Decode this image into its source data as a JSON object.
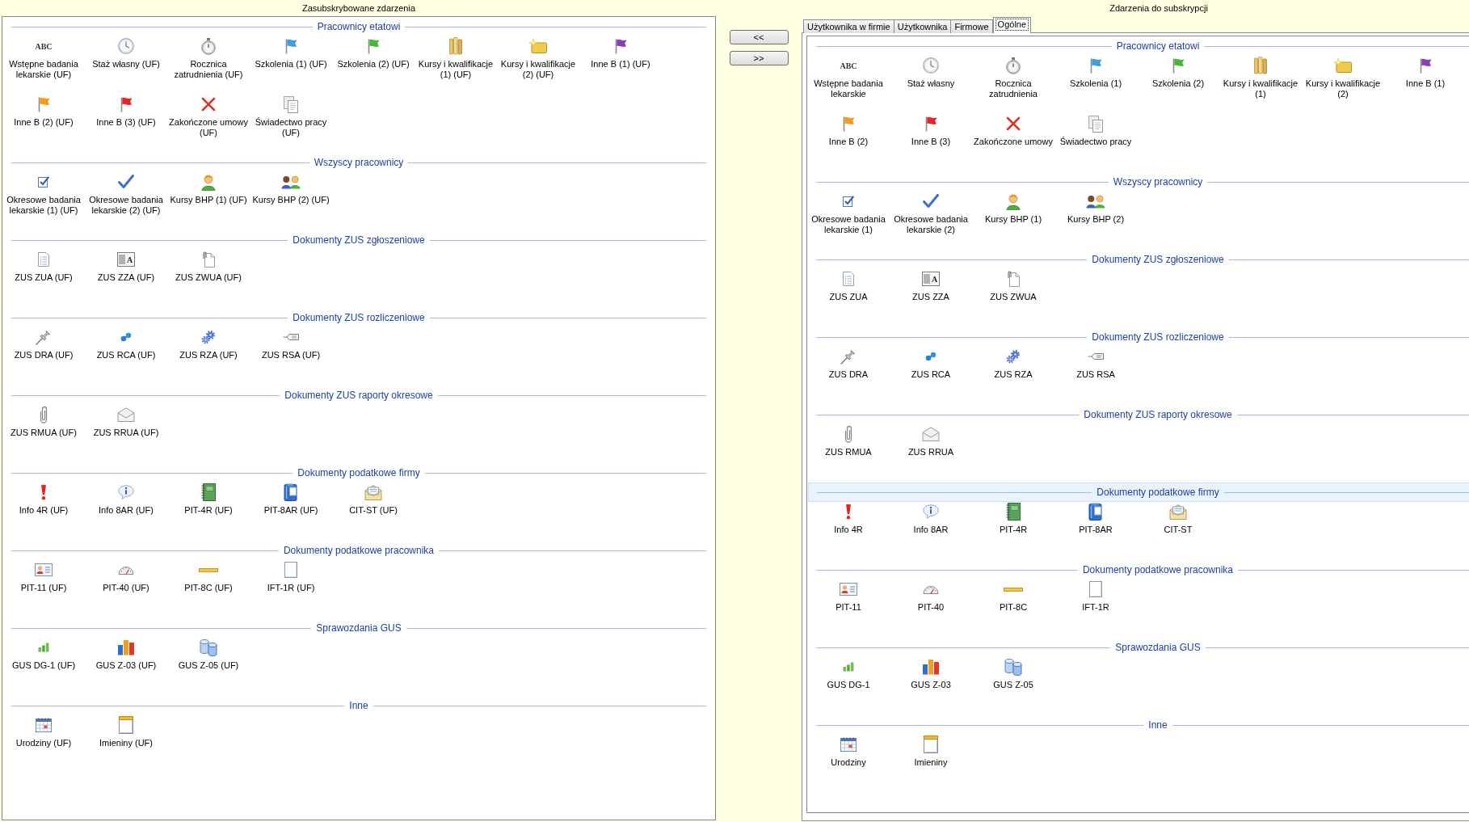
{
  "left_panel": {
    "title": "Zasubskrybowane zdarzenia",
    "groups": [
      {
        "title": "Pracownicy etatowi",
        "items": [
          {
            "label": "Wstępne badania lekarskie (UF)",
            "icon_text": "ABC"
          },
          {
            "label": "Staż własny (UF)"
          },
          {
            "label": "Rocznica zatrudnienia (UF)"
          },
          {
            "label": "Szkolenia (1) (UF)"
          },
          {
            "label": "Szkolenia (2) (UF)"
          },
          {
            "label": "Kursy i kwalifikacje (1) (UF)"
          },
          {
            "label": "Kursy i kwalifikacje (2) (UF)"
          },
          {
            "label": "Inne B (1) (UF)"
          },
          {
            "label": "Inne B (2) (UF)"
          },
          {
            "label": "Inne B (3) (UF)"
          },
          {
            "label": "Zakończone umowy (UF)"
          },
          {
            "label": "Świadectwo pracy (UF)"
          }
        ]
      },
      {
        "title": "Wszyscy pracownicy",
        "items": [
          {
            "label": "Okresowe badania lekarskie (1) (UF)"
          },
          {
            "label": "Okresowe badania lekarskie (2) (UF)"
          },
          {
            "label": "Kursy BHP (1) (UF)"
          },
          {
            "label": "Kursy BHP (2) (UF)"
          }
        ]
      },
      {
        "title": "Dokumenty ZUS zgłoszeniowe",
        "items": [
          {
            "label": "ZUS ZUA (UF)"
          },
          {
            "label": "ZUS ZZA (UF)",
            "icon_text": "A"
          },
          {
            "label": "ZUS ZWUA (UF)"
          }
        ]
      },
      {
        "title": "Dokumenty ZUS rozliczeniowe",
        "items": [
          {
            "label": "ZUS DRA (UF)"
          },
          {
            "label": "ZUS RCA (UF)"
          },
          {
            "label": "ZUS RZA (UF)"
          },
          {
            "label": "ZUS RSA (UF)"
          }
        ]
      },
      {
        "title": "Dokumenty ZUS raporty okresowe",
        "items": [
          {
            "label": "ZUS RMUA (UF)"
          },
          {
            "label": "ZUS RRUA (UF)"
          }
        ]
      },
      {
        "title": "Dokumenty podatkowe firmy",
        "items": [
          {
            "label": "Info 4R (UF)"
          },
          {
            "label": "Info 8AR (UF)"
          },
          {
            "label": "PIT-4R (UF)"
          },
          {
            "label": "PIT-8AR (UF)"
          },
          {
            "label": "CIT-ST (UF)"
          }
        ]
      },
      {
        "title": "Dokumenty podatkowe pracownika",
        "items": [
          {
            "label": "PIT-11 (UF)"
          },
          {
            "label": "PIT-40 (UF)"
          },
          {
            "label": "PIT-8C (UF)"
          },
          {
            "label": "IFT-1R (UF)"
          }
        ]
      },
      {
        "title": "Sprawozdania GUS",
        "items": [
          {
            "label": "GUS DG-1 (UF)"
          },
          {
            "label": "GUS Z-03 (UF)"
          },
          {
            "label": "GUS Z-05 (UF)"
          }
        ]
      },
      {
        "title": "Inne",
        "items": [
          {
            "label": "Urodziny (UF)"
          },
          {
            "label": "Imieniny (UF)"
          }
        ]
      }
    ]
  },
  "transfer_buttons": [
    "<<",
    ">>"
  ],
  "right_panel": {
    "title": "Zdarzenia do subskrypcji",
    "tabs": [
      {
        "label": "Użytkownika w firmie",
        "selected": false
      },
      {
        "label": "Użytkownika",
        "selected": false
      },
      {
        "label": "Firmowe",
        "selected": false
      },
      {
        "label": "Ogólne",
        "selected": true
      }
    ],
    "groups": [
      {
        "title": "Pracownicy etatowi",
        "highlighted": false,
        "items": [
          {
            "label": "Wstępne badania lekarskie",
            "icon_text": "ABC"
          },
          {
            "label": "Staż własny"
          },
          {
            "label": "Rocznica zatrudnienia"
          },
          {
            "label": "Szkolenia (1)"
          },
          {
            "label": "Szkolenia (2)"
          },
          {
            "label": "Kursy i kwalifikacje (1)"
          },
          {
            "label": "Kursy i kwalifikacje (2)"
          },
          {
            "label": "Inne B (1)"
          },
          {
            "label": "Inne B (2)"
          },
          {
            "label": "Inne B (3)"
          },
          {
            "label": "Zakończone umowy"
          },
          {
            "label": "Świadectwo pracy"
          }
        ]
      },
      {
        "title": "Wszyscy pracownicy",
        "highlighted": false,
        "items": [
          {
            "label": "Okresowe badania lekarskie (1)"
          },
          {
            "label": "Okresowe badania lekarskie (2)"
          },
          {
            "label": "Kursy BHP (1)"
          },
          {
            "label": "Kursy BHP (2)"
          }
        ]
      },
      {
        "title": "Dokumenty ZUS zgłoszeniowe",
        "highlighted": false,
        "items": [
          {
            "label": "ZUS ZUA"
          },
          {
            "label": "ZUS ZZA",
            "icon_text": "A"
          },
          {
            "label": "ZUS ZWUA"
          }
        ]
      },
      {
        "title": "Dokumenty ZUS rozliczeniowe",
        "highlighted": false,
        "items": [
          {
            "label": "ZUS DRA"
          },
          {
            "label": "ZUS RCA"
          },
          {
            "label": "ZUS RZA"
          },
          {
            "label": "ZUS RSA"
          }
        ]
      },
      {
        "title": "Dokumenty ZUS raporty okresowe",
        "highlighted": false,
        "items": [
          {
            "label": "ZUS RMUA"
          },
          {
            "label": "ZUS RRUA"
          }
        ]
      },
      {
        "title": "Dokumenty podatkowe firmy",
        "highlighted": true,
        "items": [
          {
            "label": "Info 4R"
          },
          {
            "label": "Info 8AR"
          },
          {
            "label": "PIT-4R"
          },
          {
            "label": "PIT-8AR"
          },
          {
            "label": "CIT-ST"
          }
        ]
      },
      {
        "title": "Dokumenty podatkowe pracownika",
        "highlighted": false,
        "items": [
          {
            "label": "PIT-11"
          },
          {
            "label": "PIT-40"
          },
          {
            "label": "PIT-8C"
          },
          {
            "label": "IFT-1R"
          }
        ]
      },
      {
        "title": "Sprawozdania GUS",
        "highlighted": false,
        "items": [
          {
            "label": "GUS DG-1"
          },
          {
            "label": "GUS Z-03"
          },
          {
            "label": "GUS Z-05"
          }
        ]
      },
      {
        "title": "Inne",
        "highlighted": false,
        "items": [
          {
            "label": "Urodziny"
          },
          {
            "label": "Imieniny"
          }
        ]
      }
    ]
  }
}
